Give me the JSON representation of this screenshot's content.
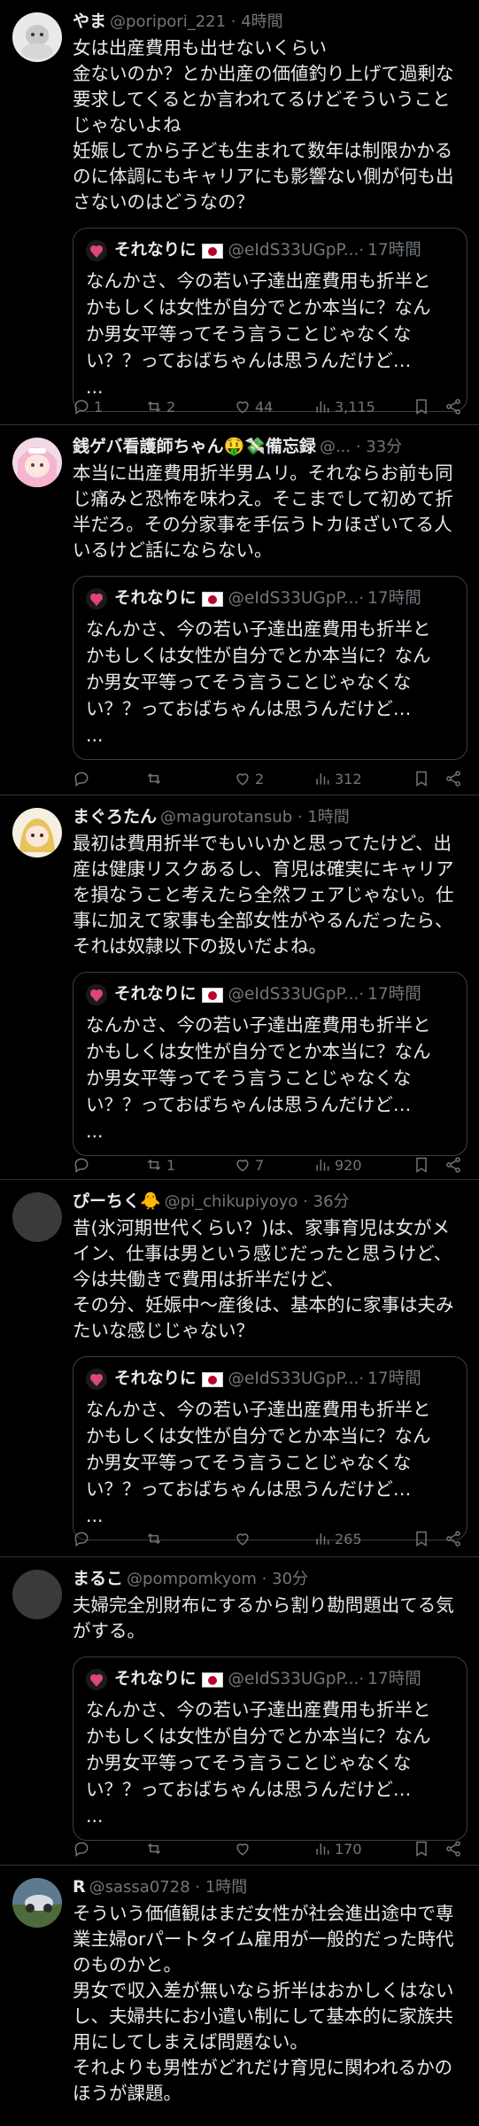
{
  "quote": {
    "name": "それなりに",
    "handle": "@eIdS33UGpP...",
    "time": "17時間",
    "text": "なんかさ、今の若い子達出産費用も折半と\nかもしくは女性が自分でとか本当に？なん\nか男女平等ってそう言うことじゃなくな\nい？？っておばちゃんは思うんだけど…\n..."
  },
  "tweets": [
    {
      "name": "やま",
      "handle": "@poripori_221",
      "time": "4時間",
      "text": "女は出産費用も出せないくらい\n金ないのか？とか出産の価値釣り上げて過剰な\n要求してくるとか言われてるけどそういうこと\nじゃないよね\n妊娠してから子ども生まれて数年は制限かかる\nのに体調にもキャリアにも影響ない側が何も出\nさないのはどうなの？",
      "reply": "1",
      "retweet": "2",
      "like": "44",
      "views": "3,115",
      "avatar": "avatar-yama"
    },
    {
      "name": "銭ゲバ看護師ちゃん🤑💸備忘録",
      "handle": "@...",
      "time": "33分",
      "text": "本当に出産費用折半男ムリ。それならお前も同\nじ痛みと恐怖を味わえ。そこまでして初めて折\n半だろ。その分家事を手伝うトカほざいてる人\nいるけど話にならない。",
      "reply": "",
      "retweet": "",
      "like": "2",
      "views": "312",
      "avatar": "avatar-zenigeba"
    },
    {
      "name": "まぐろたん",
      "handle": "@magurotansub",
      "time": "1時間",
      "text": "最初は費用折半でもいいかと思ってたけど、出\n産は健康リスクあるし、育児は確実にキャリア\nを損なうこと考えたら全然フェアじゃない。仕\n事に加えて家事も全部女性がやるんだったら、\nそれは奴隷以下の扱いだよね。",
      "reply": "",
      "retweet": "1",
      "like": "7",
      "views": "920",
      "avatar": "avatar-maguro"
    },
    {
      "name": "ぴーちく🐥",
      "handle": "@pi_chikupiyoyo",
      "time": "36分",
      "text": "昔(氷河期世代くらい？)は、家事育児は女がメ\nイン、仕事は男という感じだったと思うけど、\n今は共働きで費用は折半だけど、\nその分、妊娠中〜産後は、基本的に家事は夫み\nたいな感じじゃない？",
      "reply": "",
      "retweet": "",
      "like": "",
      "views": "265",
      "avatar": "avatar-pichiku"
    },
    {
      "name": "まるこ",
      "handle": "@pompomkyom",
      "time": "30分",
      "text": "夫婦完全別財布にするから割り勘問題出てる気\nがする。",
      "reply": "",
      "retweet": "",
      "like": "",
      "views": "170",
      "avatar": "avatar-maruko"
    },
    {
      "name": "R",
      "handle": "@sassa0728",
      "time": "1時間",
      "text": "そういう価値観はまだ女性が社会進出途中で専\n業主婦orパートタイム雇用が一般的だった時代\nのものかと。\n男女で収入差が無いなら折半はおかしくはない\nし、夫婦共にお小遣い制にして基本的に家族共\n用にしてしまえば問題ない。\nそれよりも男性がどれだけ育児に関われるかの\nほうが課題。",
      "avatar": "avatar-r"
    }
  ]
}
